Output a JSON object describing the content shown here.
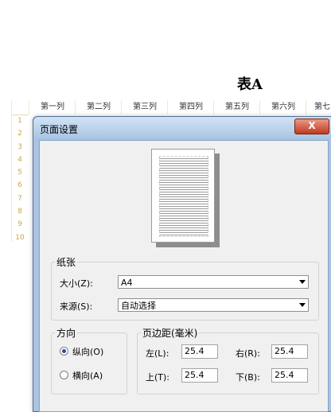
{
  "sheet": {
    "title": "表A",
    "columns": [
      "第一列",
      "第二列",
      "第三列",
      "第四列",
      "第五列",
      "第六列",
      "第七"
    ],
    "rows": [
      "1",
      "2",
      "3",
      "4",
      "5",
      "6",
      "7",
      "8",
      "9",
      "10"
    ]
  },
  "dialog": {
    "title": "页面设置",
    "close": "X",
    "paper": {
      "group": "纸张",
      "size_label": "大小(Z):",
      "size_value": "A4",
      "source_label": "来源(S):",
      "source_value": "自动选择"
    },
    "orientation": {
      "group": "方向",
      "portrait": "纵向(O)",
      "landscape": "横向(A)",
      "selected": "portrait"
    },
    "margins": {
      "group": "页边距(毫米)",
      "left_label": "左(L):",
      "left": "25.4",
      "right_label": "右(R):",
      "right": "25.4",
      "top_label": "上(T):",
      "top": "25.4",
      "bottom_label": "下(B):",
      "bottom": "25.4"
    }
  }
}
